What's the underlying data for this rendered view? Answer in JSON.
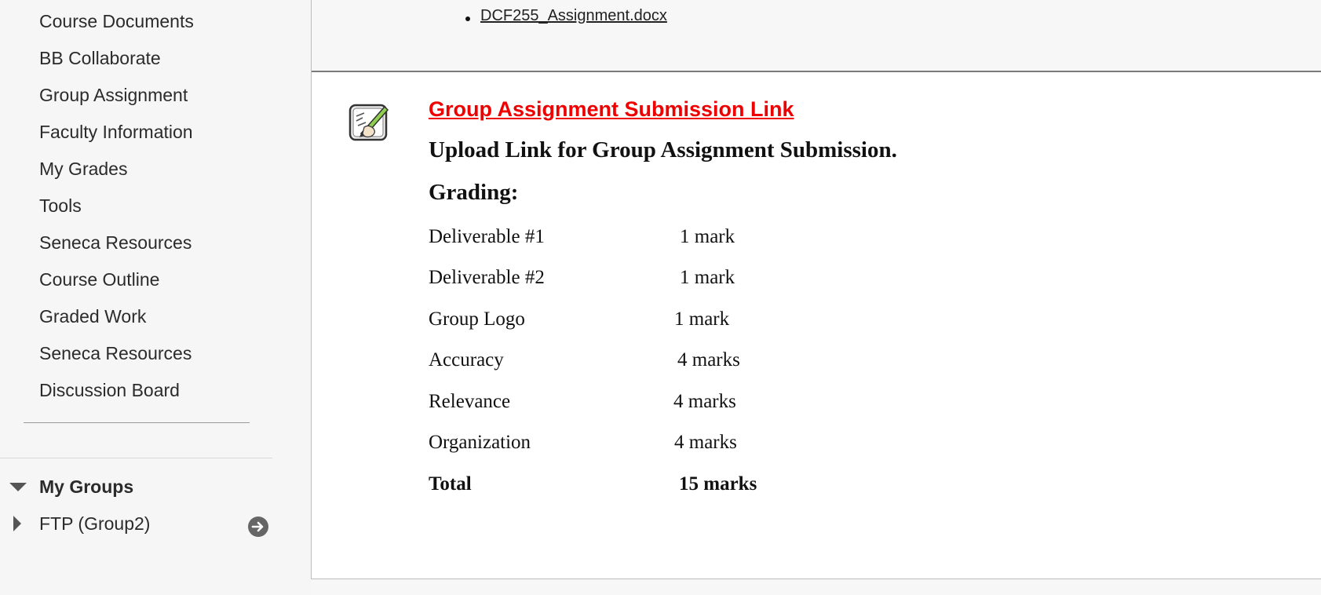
{
  "sidebar": {
    "items": [
      {
        "label": "Course Documents"
      },
      {
        "label": "BB Collaborate"
      },
      {
        "label": "Group Assignment"
      },
      {
        "label": "Faculty Information"
      },
      {
        "label": "My Grades"
      },
      {
        "label": "Tools"
      },
      {
        "label": "Seneca Resources"
      },
      {
        "label": "Course Outline"
      },
      {
        "label": "Graded Work"
      },
      {
        "label": "Seneca Resources"
      },
      {
        "label": "Discussion Board"
      }
    ],
    "groups": {
      "title": "My Groups",
      "items": [
        {
          "label": "FTP (Group2)"
        }
      ]
    }
  },
  "content": {
    "previous_item": {
      "attachment": "DCF255_Assignment.docx"
    },
    "item": {
      "title": "Group Assignment Submission Link",
      "title_color": "#ee0000",
      "icon": "assignment-icon",
      "description": "Upload Link for Group Assignment Submission.",
      "grading_heading": "Grading:",
      "grading": [
        {
          "name": "Deliverable #1",
          "mark": "1 mark"
        },
        {
          "name": "Deliverable #2",
          "mark": "1 mark"
        },
        {
          "name": "Group Logo",
          "mark": "1 mark"
        },
        {
          "name": "Accuracy",
          "mark": "4 marks"
        },
        {
          "name": "Relevance",
          "mark": "4 marks"
        },
        {
          "name": "Organization",
          "mark": "4 marks"
        }
      ],
      "total": {
        "name": "Total",
        "mark": "15 marks"
      }
    }
  }
}
